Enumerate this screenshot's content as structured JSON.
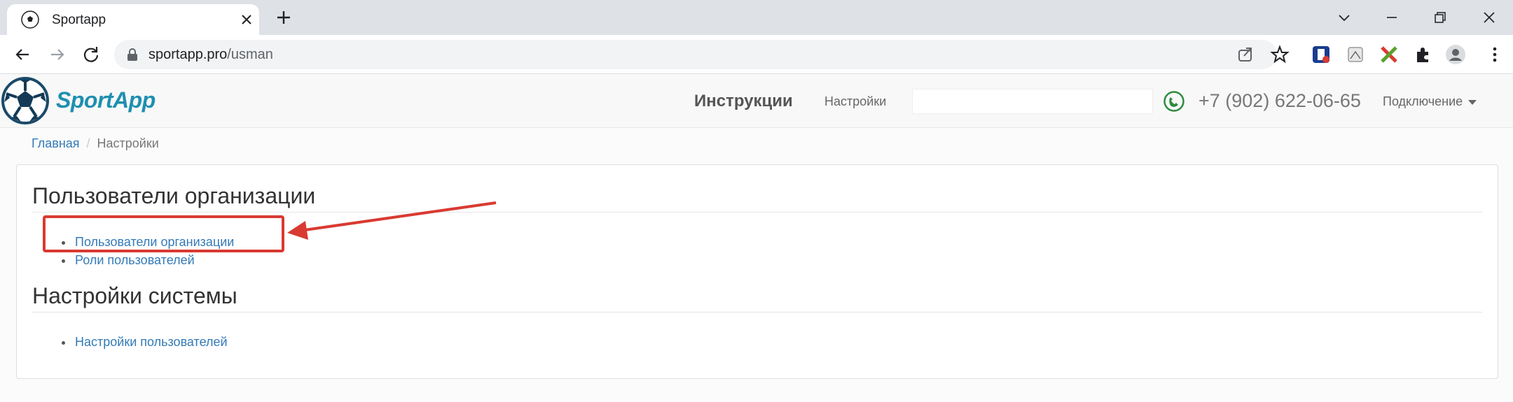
{
  "browser": {
    "tab_title": "Sportapp",
    "url_host": "sportapp.pro",
    "url_path": "/usman"
  },
  "header": {
    "logo_text": "SportApp",
    "nav_instructions": "Инструкции",
    "nav_settings": "Настройки",
    "search_value": "",
    "phone": "+7 (902) 622-06-65",
    "connect_label": "Подключение"
  },
  "breadcrumb": {
    "home": "Главная",
    "separator": "/",
    "current": "Настройки"
  },
  "sections": [
    {
      "title": "Пользователи организации",
      "items": [
        "Пользователи организации",
        "Роли пользователей"
      ]
    },
    {
      "title": "Настройки системы",
      "items": [
        "Настройки пользователей"
      ]
    }
  ],
  "colors": {
    "link": "#337ab7",
    "brand": "#1f8fb0",
    "annotation": "#d93a32"
  }
}
